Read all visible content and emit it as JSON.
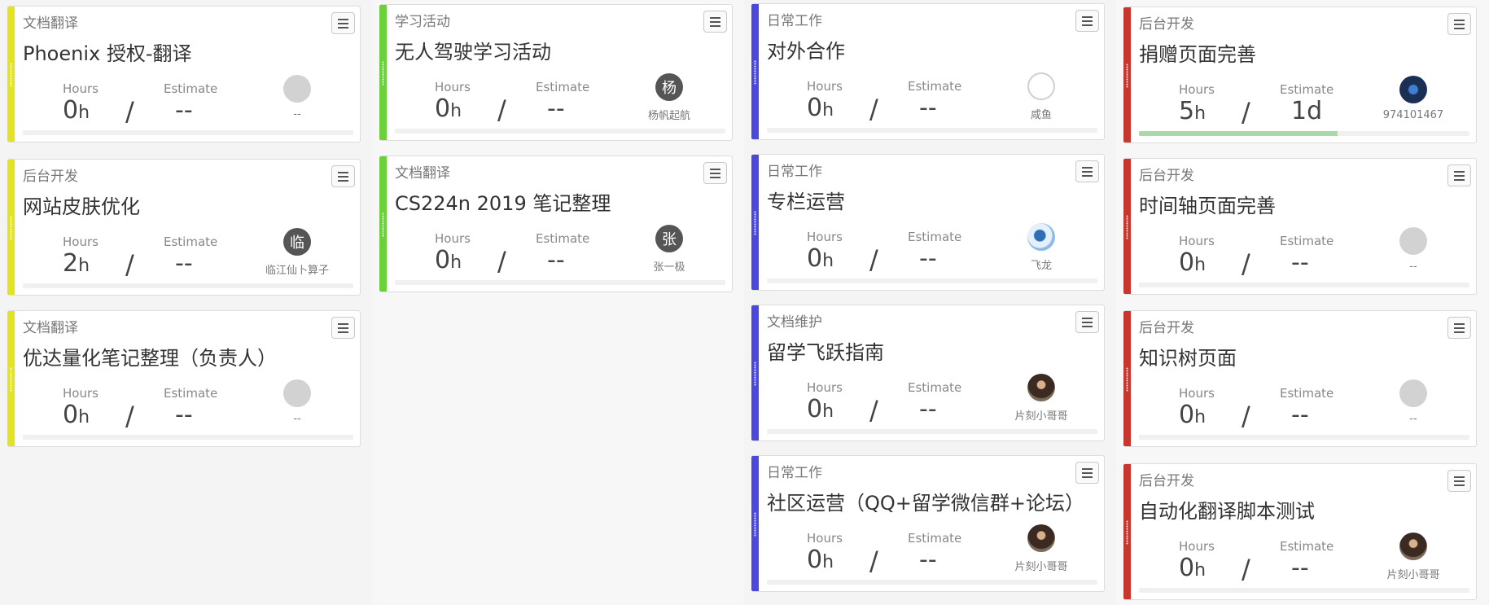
{
  "columns": [
    {
      "cards": [
        {
          "category": "文档翻译",
          "title": "Phoenix 授权-翻译",
          "hours": "0",
          "estimate": "--",
          "user": "--",
          "avatar": "",
          "progress": 0
        },
        {
          "category": "后台开发",
          "title": "网站皮肤优化",
          "hours": "2",
          "estimate": "--",
          "user": "临江仙卜算子",
          "avatar": "临",
          "progress": 0
        },
        {
          "category": "文档翻译",
          "title": "优达量化笔记整理（负责人）",
          "hours": "0",
          "estimate": "--",
          "user": "--",
          "avatar": "",
          "progress": 0
        }
      ]
    },
    {
      "cards": [
        {
          "category": "学习活动",
          "title": "无人驾驶学习活动",
          "hours": "0",
          "estimate": "--",
          "user": "杨帆起航",
          "avatar": "杨",
          "progress": 0
        },
        {
          "category": "文档翻译",
          "title": "CS224n 2019 笔记整理",
          "hours": "0",
          "estimate": "--",
          "user": "张一极",
          "avatar": "张",
          "progress": 0
        }
      ]
    },
    {
      "cards": [
        {
          "category": "日常工作",
          "title": "对外合作",
          "hours": "0",
          "estimate": "--",
          "user": "咸鱼",
          "avatar": "",
          "progress": 0
        },
        {
          "category": "日常工作",
          "title": "专栏运营",
          "hours": "0",
          "estimate": "--",
          "user": "飞龙",
          "avatar": "",
          "progress": 0
        },
        {
          "category": "文档维护",
          "title": "留学飞跃指南",
          "hours": "0",
          "estimate": "--",
          "user": "片刻小哥哥",
          "avatar": "",
          "progress": 0
        },
        {
          "category": "日常工作",
          "title": "社区运营（QQ+留学微信群+论坛）",
          "hours": "0",
          "estimate": "--",
          "user": "片刻小哥哥",
          "avatar": "",
          "progress": 0
        }
      ]
    },
    {
      "cards": [
        {
          "category": "后台开发",
          "title": "捐赠页面完善",
          "hours": "5",
          "estimate": "1d",
          "user": "974101467",
          "avatar": "",
          "progress": 0.6
        },
        {
          "category": "后台开发",
          "title": "时间轴页面完善",
          "hours": "0",
          "estimate": "--",
          "user": "--",
          "avatar": "",
          "progress": 0
        },
        {
          "category": "后台开发",
          "title": "知识树页面",
          "hours": "0",
          "estimate": "--",
          "user": "--",
          "avatar": "",
          "progress": 0
        },
        {
          "category": "后台开发",
          "title": "自动化翻译脚本测试",
          "hours": "0",
          "estimate": "--",
          "user": "片刻小哥哥",
          "avatar": "",
          "progress": 0
        }
      ]
    }
  ],
  "labels": {
    "hours": "Hours",
    "estimate": "Estimate",
    "hours_unit": "h",
    "slash": "/"
  },
  "colors": {
    "yellow": "#e3e322",
    "green": "#6ad13a",
    "blue": "#4b48e0",
    "red": "#c8372d"
  }
}
